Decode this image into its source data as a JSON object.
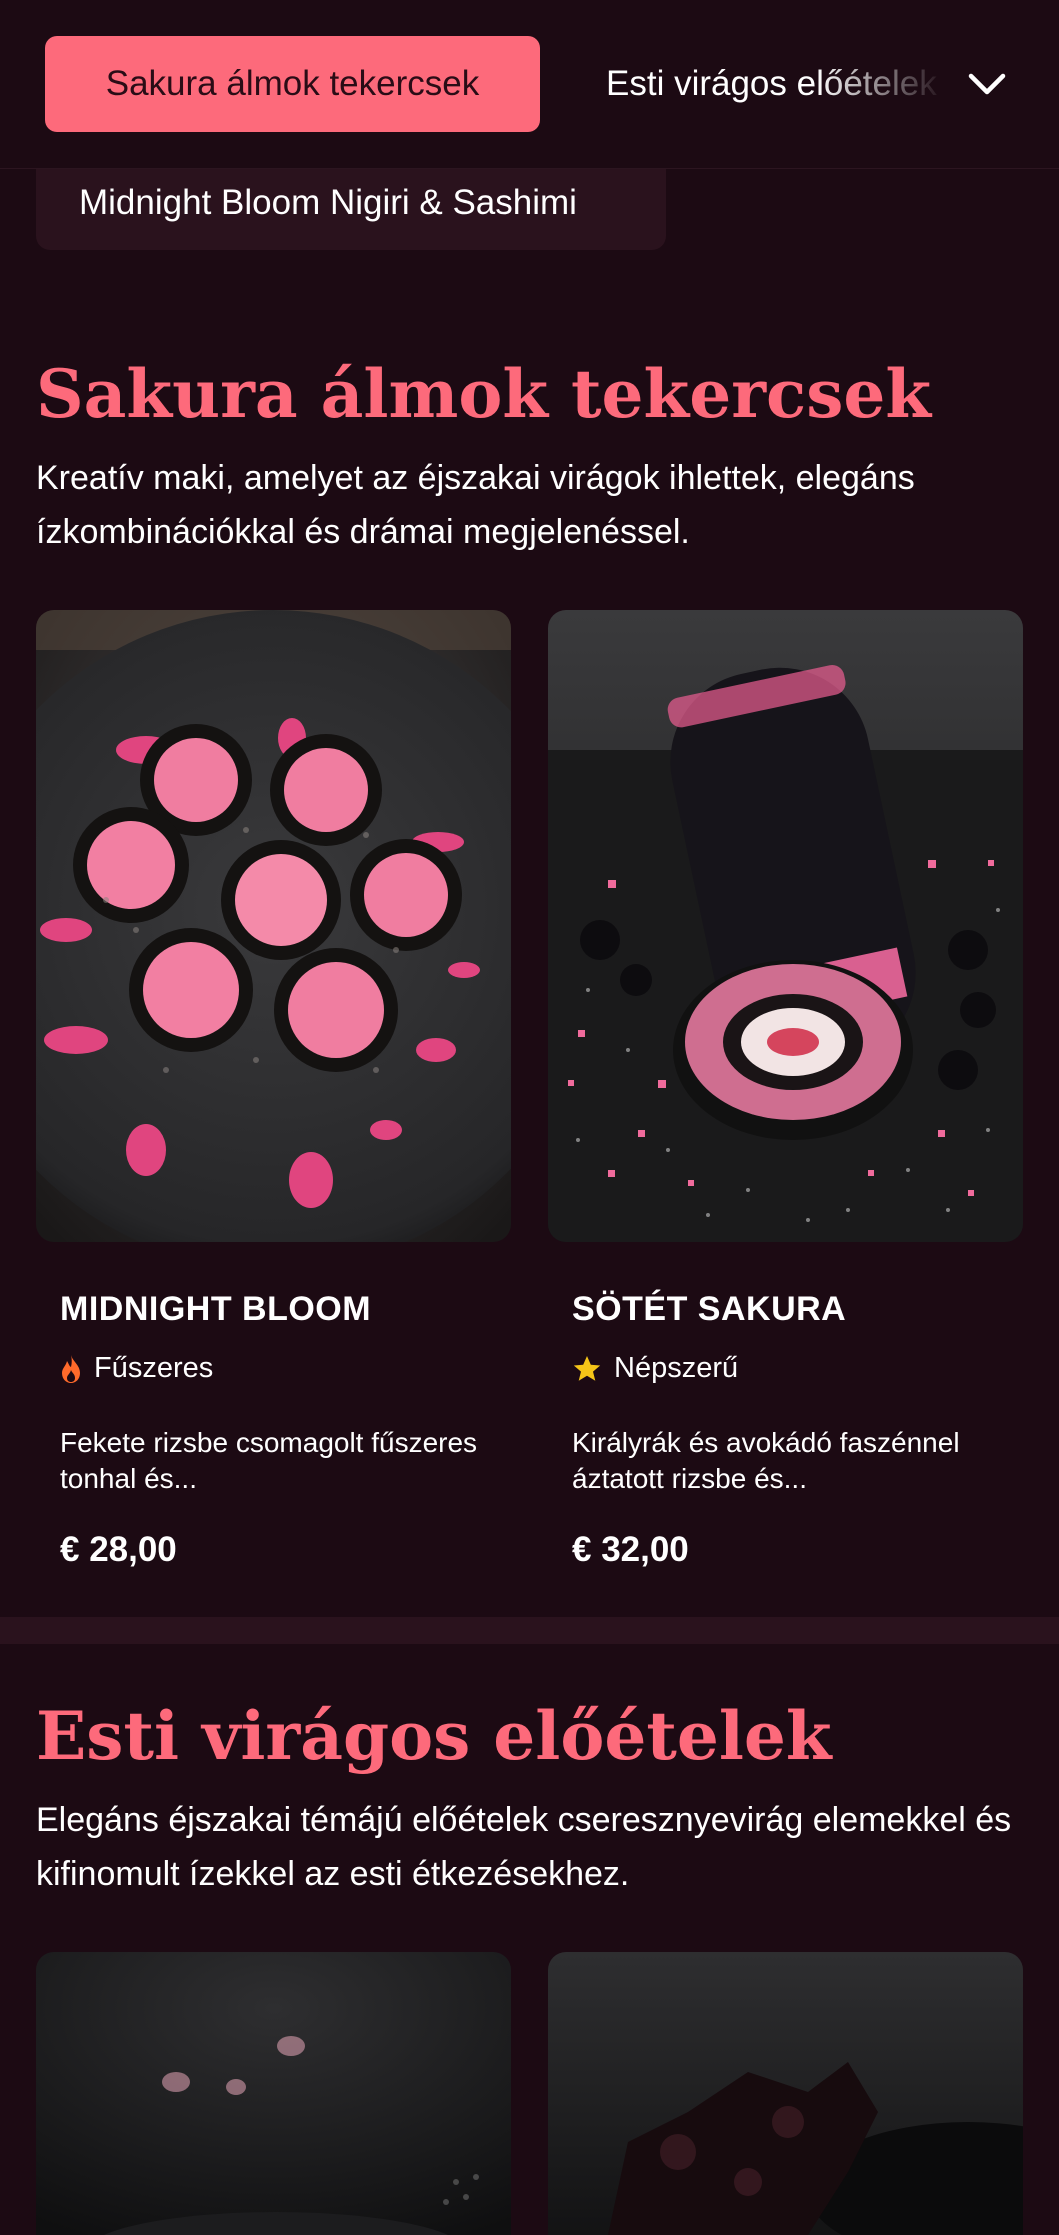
{
  "nav": {
    "active_category": "Sakura álmok tekercsek",
    "next_category": "Esti virágos előételek",
    "second_row_category": "Midnight Bloom Nigiri & Sashimi",
    "expand_icon": "chevron-down-icon"
  },
  "sections": [
    {
      "title": "Sakura álmok tekercsek",
      "description": "Kreatív maki, amelyet az éjszakai virágok ihlettek, elegáns ízkombinációkkal és drámai megjelenéssel.",
      "items": [
        {
          "name": "MIDNIGHT BLOOM",
          "tag": "Fűszeres",
          "tag_icon": "flame-icon",
          "description": "Fekete rizsbe csomagolt fűszeres tonhal és...",
          "price": "€ 28,00"
        },
        {
          "name": "SÖTÉT SAKURA",
          "tag": "Népszerű",
          "tag_icon": "star-icon",
          "description": "Királyrák és avokádó faszénnel áztatott rizsbe és...",
          "price": "€ 32,00"
        }
      ]
    },
    {
      "title": "Esti virágos előételek",
      "description": "Elegáns éjszakai témájú előételek cseresznyevirág elemekkel és kifinomult ízekkel az esti étkezésekhez."
    }
  ],
  "colors": {
    "background": "#1c0a13",
    "accent": "#fd6a7b",
    "card_surface": "#2a121d",
    "flame": "#ff6a2b",
    "star": "#f5c518"
  }
}
